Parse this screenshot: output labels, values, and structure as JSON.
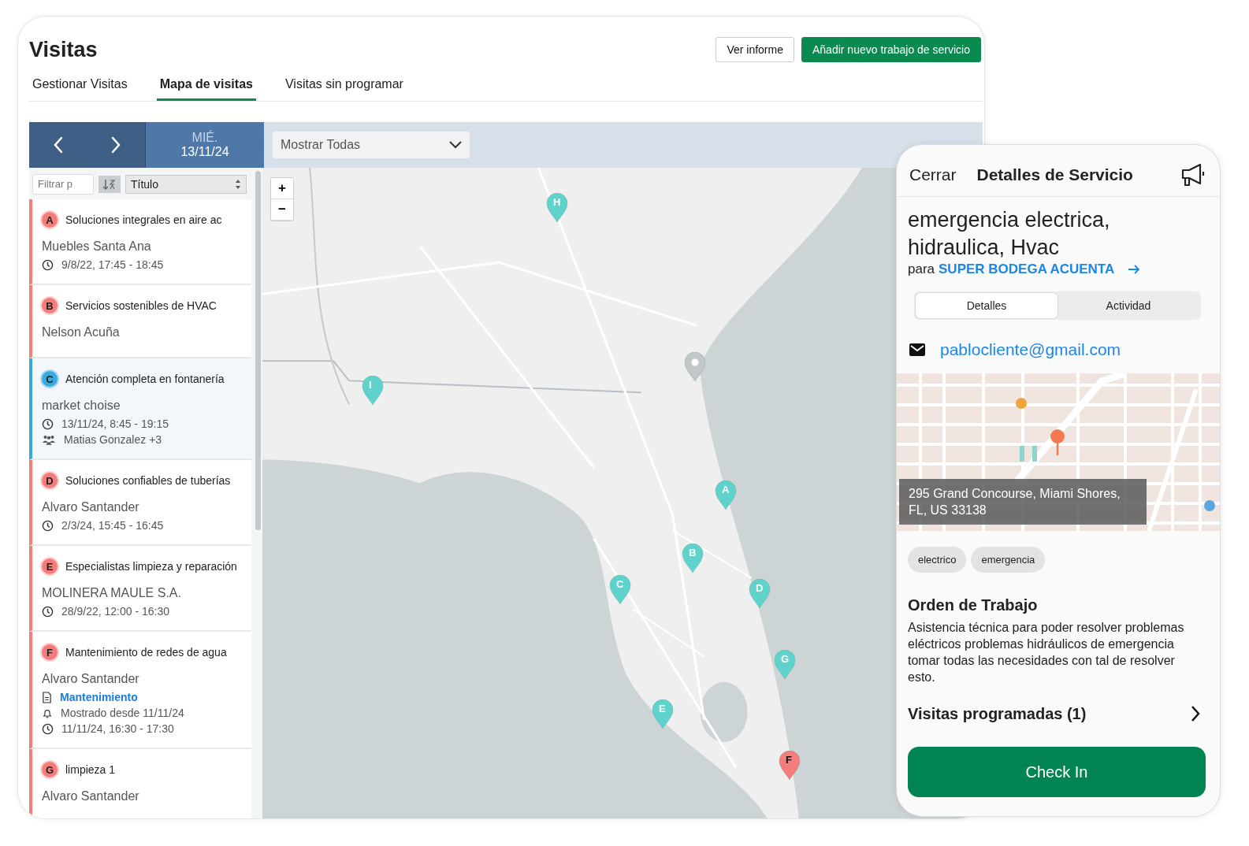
{
  "header": {
    "title": "Visitas",
    "buttons": [
      {
        "label": "Ver informe",
        "kind": "secondary"
      },
      {
        "label": "Añadir nuevo trabajo de servicio",
        "kind": "primary"
      }
    ]
  },
  "tabs": [
    {
      "label": "Gestionar Visitas",
      "selected": false
    },
    {
      "label": "Mapa de visitas",
      "selected": true
    },
    {
      "label": "Visitas sin programar",
      "selected": false
    }
  ],
  "toolbar": {
    "day": "MIÉ.",
    "date": "13/11/24",
    "filter": {
      "value": "Mostrar Todas"
    }
  },
  "list": {
    "filter": {
      "placeholder": "Filtrar p"
    },
    "sort": {
      "value": "Título"
    },
    "items": [
      {
        "letter": "A",
        "title": "Soluciones integrales en aire ac",
        "customer": "Muebles Santa Ana",
        "selected": false,
        "details": [
          {
            "kind": "time",
            "text": "9/8/22, 17:45 - 18:45"
          }
        ]
      },
      {
        "letter": "B",
        "title": "Servicios sostenibles de HVAC",
        "customer": "Nelson Acuña",
        "selected": false
      },
      {
        "letter": "C",
        "title": "Atención completa en fontanería",
        "customer": "market choise",
        "selected": true,
        "details": [
          {
            "kind": "time",
            "text": "13/11/24, 8:45 - 19:15"
          },
          {
            "kind": "team",
            "text": "Matias Gonzalez +3"
          }
        ]
      },
      {
        "letter": "D",
        "title": "Soluciones confiables de tuberías",
        "customer": "Alvaro Santander",
        "selected": false,
        "details": [
          {
            "kind": "time",
            "text": "2/3/24, 15:45 - 16:45"
          }
        ]
      },
      {
        "letter": "E",
        "title": "Especialistas limpieza y reparación",
        "customer": "MOLINERA MAULE S.A.",
        "selected": false,
        "details": [
          {
            "kind": "time",
            "text": "28/9/22, 12:00 - 16:30"
          }
        ]
      },
      {
        "letter": "F",
        "title": "Mantenimiento de redes de agua",
        "customer": "Alvaro Santander",
        "selected": false,
        "details": [
          {
            "kind": "document",
            "text": "Mantenimiento"
          },
          {
            "kind": "notification",
            "text": "Mostrado desde 11/11/24"
          },
          {
            "kind": "time",
            "text": "11/11/24, 16:30 - 17:30"
          }
        ]
      },
      {
        "letter": "G",
        "title": "limpieza 1",
        "customer": "Alvaro Santander",
        "selected": false
      }
    ]
  },
  "map": {
    "zoom_controls": [
      "+",
      "−"
    ],
    "markers": [
      {
        "kind": "visit",
        "label": "A",
        "selected": false
      },
      {
        "kind": "visit",
        "label": "B",
        "selected": false
      },
      {
        "kind": "visit",
        "label": "C",
        "selected": false
      },
      {
        "kind": "visit",
        "label": "D",
        "selected": false
      },
      {
        "kind": "visit",
        "label": "E",
        "selected": false
      },
      {
        "kind": "visit",
        "label": "F",
        "selected": true
      },
      {
        "kind": "visit",
        "label": "G",
        "selected": false
      },
      {
        "kind": "visit",
        "label": "H",
        "selected": false
      },
      {
        "kind": "visit",
        "label": "I",
        "selected": false
      },
      {
        "kind": "location",
        "selected": false
      }
    ]
  },
  "panel": {
    "close": "Cerrar",
    "title": "Detalles de Servicio",
    "job_title": "emergencia electrica, hidraulica, Hvac",
    "for_label": "para",
    "client": "SUPER BODEGA ACUENTA",
    "segments": [
      {
        "label": "Detalles",
        "selected": true
      },
      {
        "label": "Actividad",
        "selected": false
      }
    ],
    "email": "pablocliente@gmail.com",
    "address": "295 Grand Concourse, Miami Shores, FL, US 33138",
    "tags": [
      "electrico",
      "emergencia"
    ],
    "order_heading": "Orden de Trabajo",
    "order_text": "Asistencia técnica para poder resolver problemas eléctricos problemas hidráulicos de emergencia tomar todas las necesidades con tal de resolver esto.",
    "visits": "Visitas programadas (1)",
    "check_in": "Check In"
  }
}
